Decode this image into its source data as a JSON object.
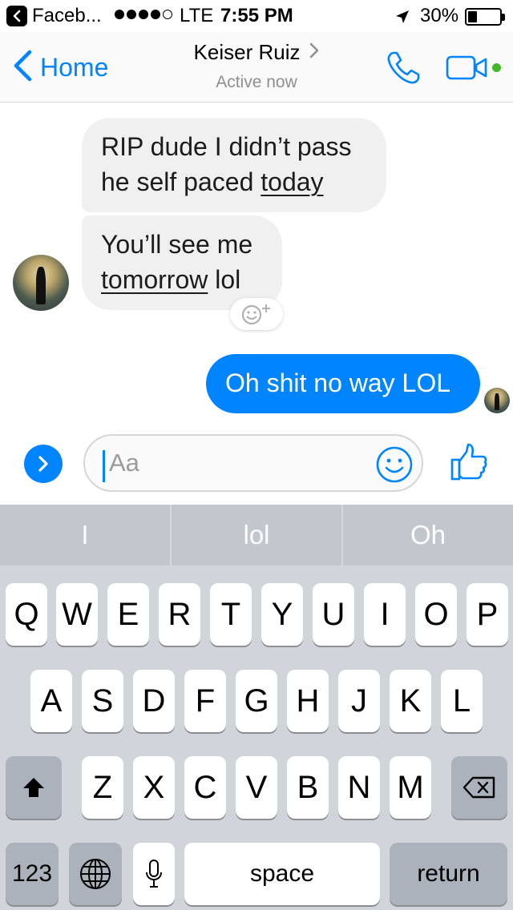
{
  "status_bar": {
    "back_app": "Faceb...",
    "carrier": "LTE",
    "time": "7:55 PM",
    "battery": "30%",
    "battery_level": 0.3
  },
  "nav": {
    "back_label": "Home",
    "contact_name": "Keiser Ruiz",
    "contact_status": "Active now"
  },
  "messages": [
    {
      "direction": "incoming",
      "parts": [
        {
          "text": "RIP dude I didn’t pass"
        },
        {
          "text": "he self paced "
        },
        {
          "text": "today"
        }
      ]
    },
    {
      "direction": "incoming",
      "parts": [
        {
          "text": "You’ll see me"
        },
        {
          "text": "tomorrow"
        },
        {
          "text": " lol"
        }
      ]
    },
    {
      "direction": "outgoing",
      "text": "Oh shit no way LOL"
    }
  ],
  "composer": {
    "placeholder": "Aa"
  },
  "keyboard": {
    "suggestions": [
      "I",
      "lol",
      "Oh"
    ],
    "row1": [
      "Q",
      "W",
      "E",
      "R",
      "T",
      "Y",
      "U",
      "I",
      "O",
      "P"
    ],
    "row2": [
      "A",
      "S",
      "D",
      "F",
      "G",
      "H",
      "J",
      "K",
      "L"
    ],
    "row3": [
      "Z",
      "X",
      "C",
      "V",
      "B",
      "N",
      "M"
    ],
    "numbers_label": "123",
    "space_label": "space",
    "return_label": "return"
  },
  "colors": {
    "messenger_blue": "#0084ff",
    "incoming_bubble": "#f1f0f0",
    "active_dot": "#42b72a",
    "keyboard_bg": "#d1d4da"
  },
  "icons": [
    "back-app-icon",
    "location-arrow-icon",
    "chevron-left-icon",
    "chevron-right-icon",
    "phone-icon",
    "video-camera-icon",
    "sticker-add-icon",
    "expand-arrow-icon",
    "emoji-icon",
    "thumbs-up-icon",
    "shift-icon",
    "backspace-icon",
    "globe-icon",
    "microphone-icon"
  ]
}
